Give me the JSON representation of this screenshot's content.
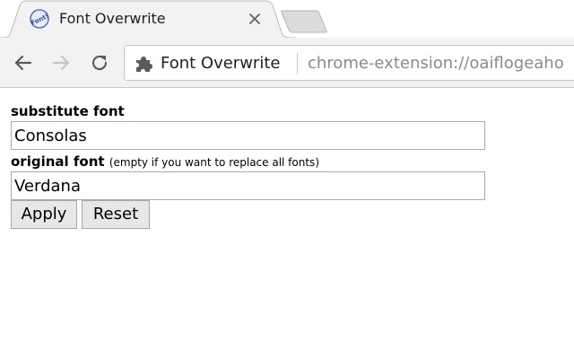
{
  "browser": {
    "tab": {
      "title": "Font Overwrite",
      "favicon_icon": "font-icon",
      "favicon_text": "Font!"
    },
    "toolbar": {
      "back_icon": "arrow-left-icon",
      "forward_icon": "arrow-right-icon",
      "reload_icon": "reload-icon",
      "origin_chip": "Font Overwrite",
      "origin_icon": "puzzle-piece-icon",
      "url": "chrome-extension://oaiflogeaho"
    }
  },
  "form": {
    "substitute_label": "substitute font",
    "substitute_value": "Consolas",
    "original_label": "original font",
    "original_hint": "(empty if you want to replace all fonts)",
    "original_value": "Verdana",
    "apply_label": "Apply",
    "reset_label": "Reset"
  },
  "colors": {
    "toolbar_bg": "#f2f2f2",
    "url_gray": "#8a8a8a",
    "button_bg": "#e7e7e7",
    "input_border": "#a9a9a9"
  }
}
